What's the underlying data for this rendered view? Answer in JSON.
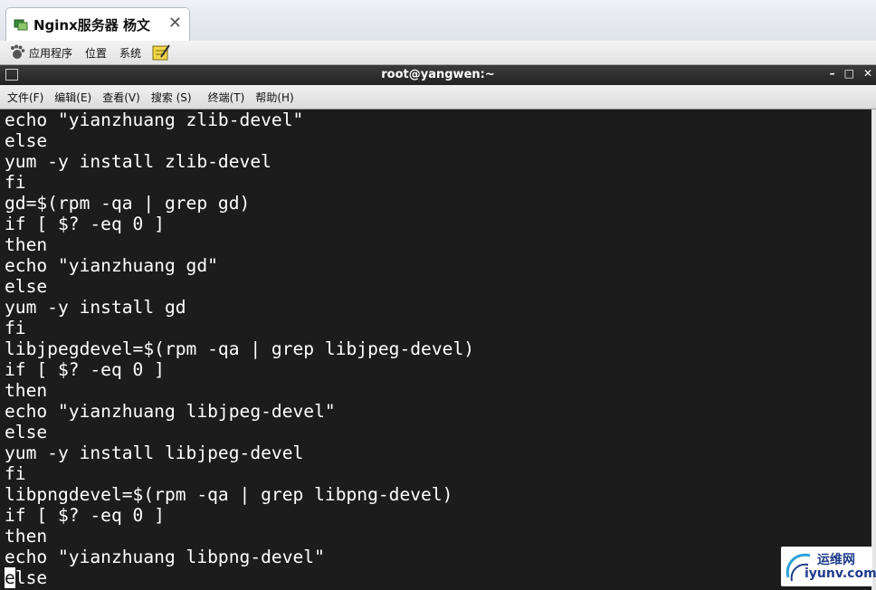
{
  "tab": {
    "title": "Nginx服务器 杨文",
    "close": "✕"
  },
  "panel": {
    "applications": "应用程序",
    "places": "位置",
    "system": "系统"
  },
  "window": {
    "title": "root@yangwen:~",
    "minimize": "–",
    "maximize": "□",
    "close": "✕"
  },
  "menu": [
    "文件(F)",
    "编辑(E)",
    "查看(V)",
    "搜索 (S)",
    "终端(T)",
    "帮助(H)"
  ],
  "terminal": {
    "lines": [
      "echo \"yianzhuang zlib-devel\"",
      "else",
      "yum -y install zlib-devel",
      "fi",
      "gd=$(rpm -qa | grep gd)",
      "if [ $? -eq 0 ]",
      "then",
      "echo \"yianzhuang gd\"",
      "else",
      "yum -y install gd",
      "fi",
      "libjpegdevel=$(rpm -qa | grep libjpeg-devel)",
      "if [ $? -eq 0 ]",
      "then",
      "echo \"yianzhuang libjpeg-devel\"",
      "else",
      "yum -y install libjpeg-devel",
      "fi",
      "libpngdevel=$(rpm -qa | grep libpng-devel)",
      "if [ $? -eq 0 ]",
      "then",
      "echo \"yianzhuang libpng-devel\""
    ],
    "last_line_cursor": "e",
    "last_line_rest": "lse"
  },
  "watermark": {
    "cn": "运维网",
    "en": "iyunv.com"
  }
}
